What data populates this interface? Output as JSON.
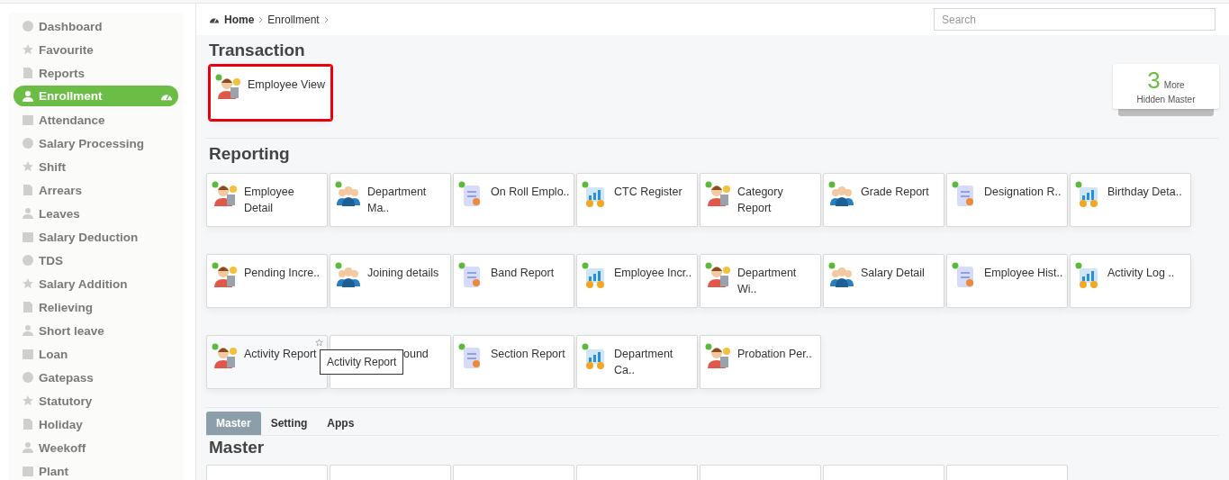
{
  "sidebar": {
    "items": [
      {
        "label": "Dashboard",
        "selected": false
      },
      {
        "label": "Favourite",
        "selected": false
      },
      {
        "label": "Reports",
        "selected": false
      },
      {
        "label": "Enrollment",
        "selected": true
      },
      {
        "label": "Attendance",
        "selected": false
      },
      {
        "label": "Salary Processing",
        "selected": false
      },
      {
        "label": "Shift",
        "selected": false
      },
      {
        "label": "Arrears",
        "selected": false
      },
      {
        "label": "Leaves",
        "selected": false
      },
      {
        "label": "Salary Deduction",
        "selected": false
      },
      {
        "label": "TDS",
        "selected": false
      },
      {
        "label": "Salary Addition",
        "selected": false
      },
      {
        "label": "Relieving",
        "selected": false
      },
      {
        "label": "Short leave",
        "selected": false
      },
      {
        "label": "Loan",
        "selected": false
      },
      {
        "label": "Gatepass",
        "selected": false
      },
      {
        "label": "Statutory",
        "selected": false
      },
      {
        "label": "Holiday",
        "selected": false
      },
      {
        "label": "Weekoff",
        "selected": false
      },
      {
        "label": "Plant",
        "selected": false
      }
    ]
  },
  "breadcrumb": [
    "Home",
    "Enrollment"
  ],
  "search": {
    "placeholder": "Search"
  },
  "hidden_master": {
    "count": "3",
    "more": "More",
    "label": "Hidden Master"
  },
  "transaction": {
    "title": "Transaction",
    "cards": [
      {
        "label": "Employee View",
        "highlighted": true,
        "hovered": false
      }
    ]
  },
  "reporting": {
    "title": "Reporting",
    "rows": [
      [
        {
          "label": "Employee Detail",
          "highlighted": false,
          "hovered": false
        },
        {
          "label": "Department Ma..",
          "highlighted": false,
          "hovered": false
        },
        {
          "label": "On Roll Emplo..",
          "highlighted": false,
          "hovered": false
        },
        {
          "label": "CTC Register",
          "highlighted": false,
          "hovered": false
        },
        {
          "label": "Category Report",
          "highlighted": false,
          "hovered": false
        },
        {
          "label": "Grade Report",
          "highlighted": false,
          "hovered": false
        },
        {
          "label": "Designation R..",
          "highlighted": false,
          "hovered": false
        },
        {
          "label": "Birthday Deta..",
          "highlighted": false,
          "hovered": false
        }
      ],
      [
        {
          "label": "Pending Incre..",
          "highlighted": false,
          "hovered": false
        },
        {
          "label": "Joining details",
          "highlighted": false,
          "hovered": false
        },
        {
          "label": "Band Report",
          "highlighted": false,
          "hovered": false
        },
        {
          "label": "Employee Incr..",
          "highlighted": false,
          "hovered": false
        },
        {
          "label": "Department Wi..",
          "highlighted": false,
          "hovered": false
        },
        {
          "label": "Salary Detail",
          "highlighted": false,
          "hovered": false
        },
        {
          "label": "Employee Hist..",
          "highlighted": false,
          "hovered": false
        },
        {
          "label": "Activity Log ..",
          "highlighted": false,
          "hovered": false
        }
      ],
      [
        {
          "label": "Activity Report",
          "highlighted": false,
          "hovered": true,
          "tooltip": "Activity Report"
        },
        {
          "label": "ound",
          "highlighted": false,
          "hovered": false,
          "covered": true
        },
        {
          "label": "Section Report",
          "highlighted": false,
          "hovered": false
        },
        {
          "label": "Department Ca..",
          "highlighted": false,
          "hovered": false
        },
        {
          "label": "Probation Per..",
          "highlighted": false,
          "hovered": false
        }
      ]
    ]
  },
  "tabs": [
    {
      "label": "Master",
      "selected": true
    },
    {
      "label": "Setting",
      "selected": false
    },
    {
      "label": "Apps",
      "selected": false
    }
  ],
  "master": {
    "title": "Master",
    "tiles": [
      {
        "kind": "blank"
      },
      {
        "kind": "blank"
      },
      {
        "kind": "blank"
      },
      {
        "kind": "blank"
      },
      {
        "kind": "blank"
      },
      {
        "kind": "blank"
      },
      {
        "kind": "blank"
      }
    ]
  }
}
